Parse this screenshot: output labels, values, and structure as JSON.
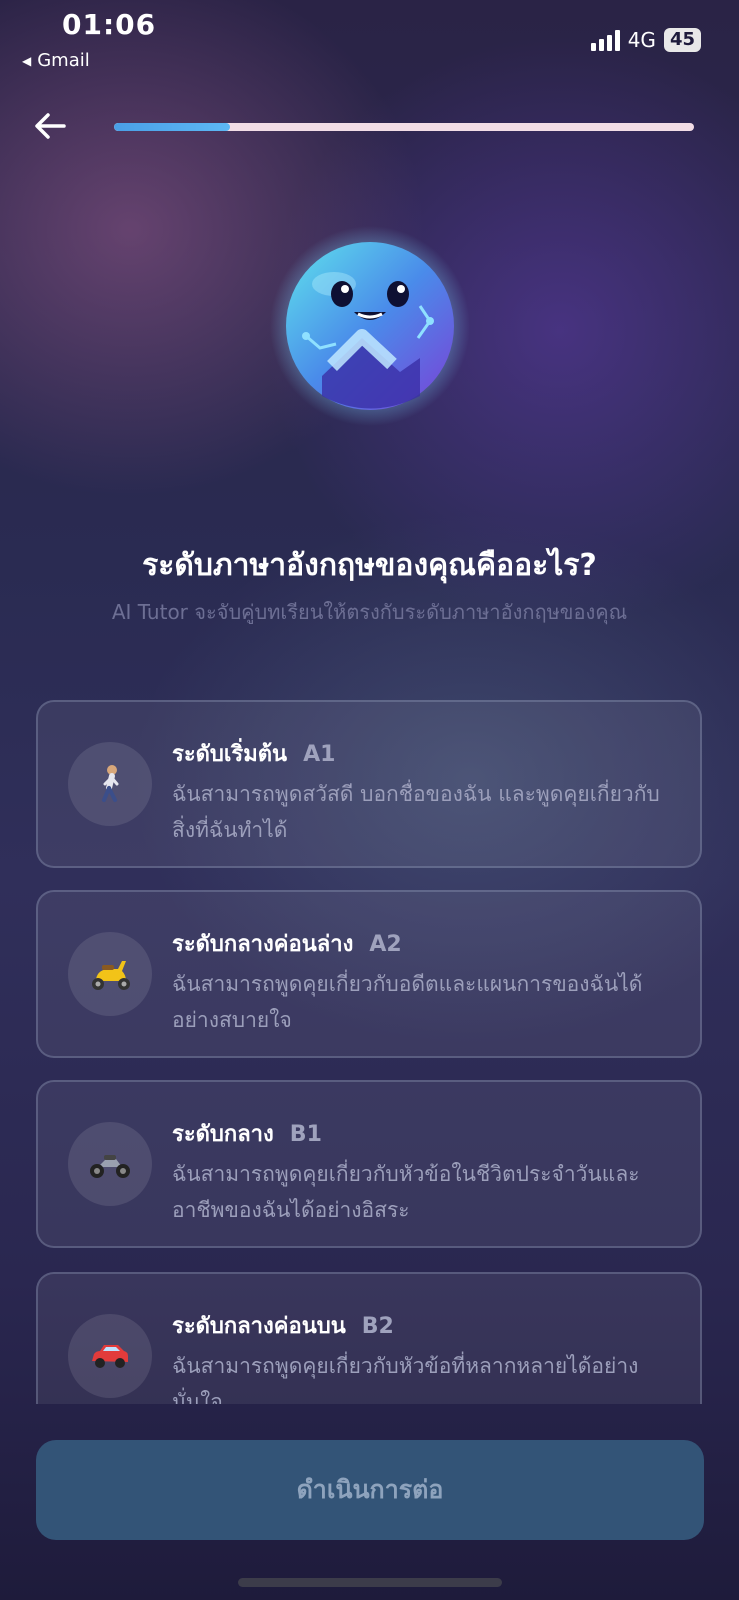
{
  "status_bar": {
    "time": "01:06",
    "back_app": "Gmail",
    "network": "4G",
    "battery": "45"
  },
  "header": {
    "back_icon": "arrow-left-icon",
    "progress_fraction": 0.2
  },
  "question": {
    "title": "ระดับภาษาอังกฤษของคุณคืออะไร?",
    "subtitle": "AI Tutor จะจับคู่บทเรียนให้ตรงกับระดับภาษาอังกฤษของคุณ"
  },
  "levels": [
    {
      "name": "ระดับเริ่มต้น",
      "code": "A1",
      "icon": "walking-person-icon",
      "description": "ฉันสามารถพูดสวัสดี บอกชื่อของฉัน และพูดคุยเกี่ยวกับสิ่งที่ฉันทำได้"
    },
    {
      "name": "ระดับกลางค่อนล่าง",
      "code": "A2",
      "icon": "scooter-icon",
      "description": "ฉันสามารถพูดคุยเกี่ยวกับอดีตและแผนการของฉันได้อย่างสบายใจ"
    },
    {
      "name": "ระดับกลาง",
      "code": "B1",
      "icon": "motorcycle-icon",
      "description": "ฉันสามารถพูดคุยเกี่ยวกับหัวข้อในชีวิตประจำวันและอาชีพของฉันได้อย่างอิสระ"
    },
    {
      "name": "ระดับกลางค่อนบน",
      "code": "B2",
      "icon": "car-icon",
      "description": "ฉันสามารถพูดคุยเกี่ยวกับหัวข้อที่หลากหลายได้อย่างมั่นใจ"
    }
  ],
  "continue_label": "ดำเนินการต่อ",
  "colors": {
    "accent": "#4a9fe6",
    "button_bg": "#335477",
    "card_border": "#5a5f82"
  }
}
